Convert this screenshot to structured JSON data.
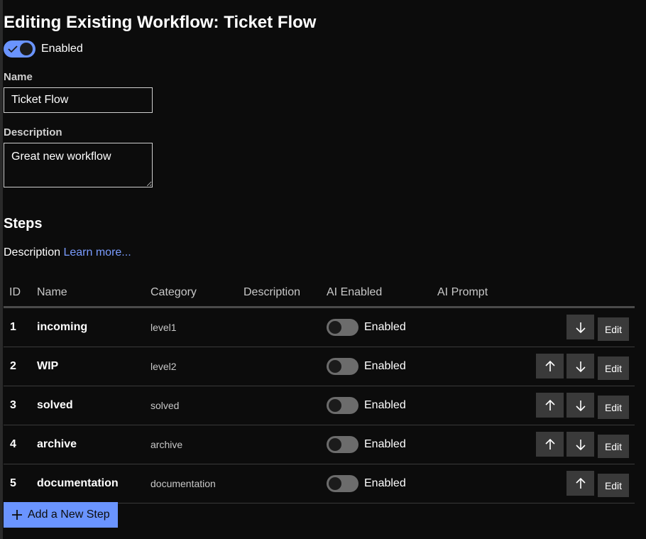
{
  "page": {
    "title": "Editing Existing Workflow: Ticket Flow",
    "enabled_label": "Enabled",
    "name_label": "Name",
    "name_value": "Ticket Flow",
    "description_label": "Description",
    "description_value": "Great new workflow"
  },
  "steps": {
    "heading": "Steps",
    "description_text": "Description",
    "learn_more": "Learn more...",
    "columns": [
      "ID",
      "Name",
      "Category",
      "Description",
      "AI Enabled",
      "AI Prompt"
    ],
    "rows": [
      {
        "id": "1",
        "name": "incoming",
        "category": "level1",
        "ai_label": "Enabled",
        "up": false,
        "down": true
      },
      {
        "id": "2",
        "name": "WIP",
        "category": "level2",
        "ai_label": "Enabled",
        "up": true,
        "down": true
      },
      {
        "id": "3",
        "name": "solved",
        "category": "solved",
        "ai_label": "Enabled",
        "up": true,
        "down": true
      },
      {
        "id": "4",
        "name": "archive",
        "category": "archive",
        "ai_label": "Enabled",
        "up": true,
        "down": true
      },
      {
        "id": "5",
        "name": "documentation",
        "category": "documentation",
        "ai_label": "Enabled",
        "up": true,
        "down": false
      }
    ],
    "edit_label": "Edit",
    "add_label": "Add a New Step"
  },
  "colors": {
    "accent": "#6a94ff",
    "background": "#0c0c0c",
    "button": "#3a3a3a"
  },
  "icons": {
    "up": "arrow-up-icon",
    "down": "arrow-down-icon",
    "plus": "plus-icon",
    "check": "check-icon"
  }
}
